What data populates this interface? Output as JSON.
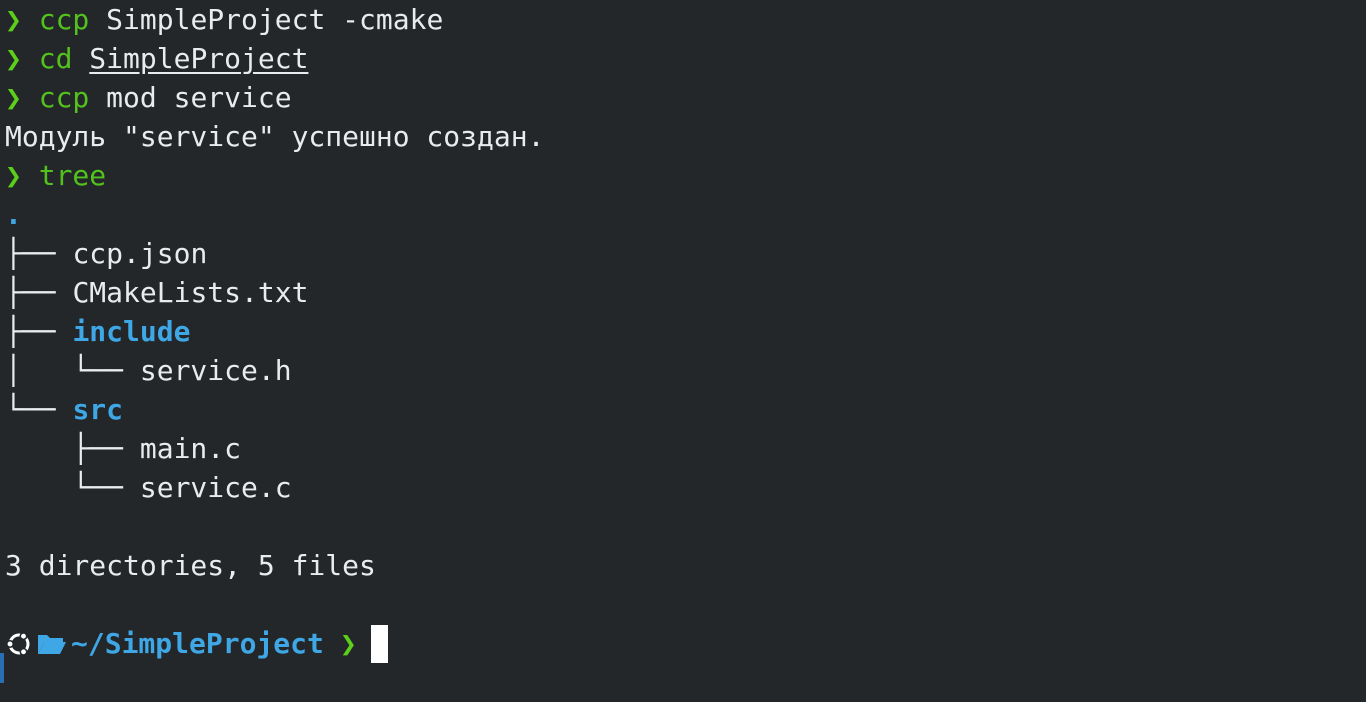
{
  "colors": {
    "background": "#232729",
    "prompt_green": "#5ccf1a",
    "command_green": "#53c21c",
    "directory_blue": "#3fa7e5",
    "text": "#e9ecec"
  },
  "prompt_char": "❯",
  "history": [
    {
      "cmd": "ccp",
      "args": " SimpleProject -cmake"
    },
    {
      "cmd": "cd",
      "args_underlined": "SimpleProject"
    },
    {
      "cmd": "ccp",
      "args": " mod service"
    }
  ],
  "output_message": "Модуль \"service\" успешно создан.",
  "tree_cmd": "tree",
  "tree": {
    "root": ".",
    "entries": [
      {
        "prefix": "├── ",
        "name": "ccp.json",
        "type": "file"
      },
      {
        "prefix": "├── ",
        "name": "CMakeLists.txt",
        "type": "file"
      },
      {
        "prefix": "├── ",
        "name": "include",
        "type": "dir"
      },
      {
        "prefix": "│   └── ",
        "name": "service.h",
        "type": "file"
      },
      {
        "prefix": "└── ",
        "name": "src",
        "type": "dir"
      },
      {
        "prefix": "    ├── ",
        "name": "main.c",
        "type": "file"
      },
      {
        "prefix": "    └── ",
        "name": "service.c",
        "type": "file"
      }
    ],
    "summary": "3 directories, 5 files"
  },
  "current_prompt": {
    "os_icon": "ubuntu-icon",
    "folder_icon": "folder-open-icon",
    "path": "~/SimpleProject",
    "prompt_char": "❯"
  }
}
